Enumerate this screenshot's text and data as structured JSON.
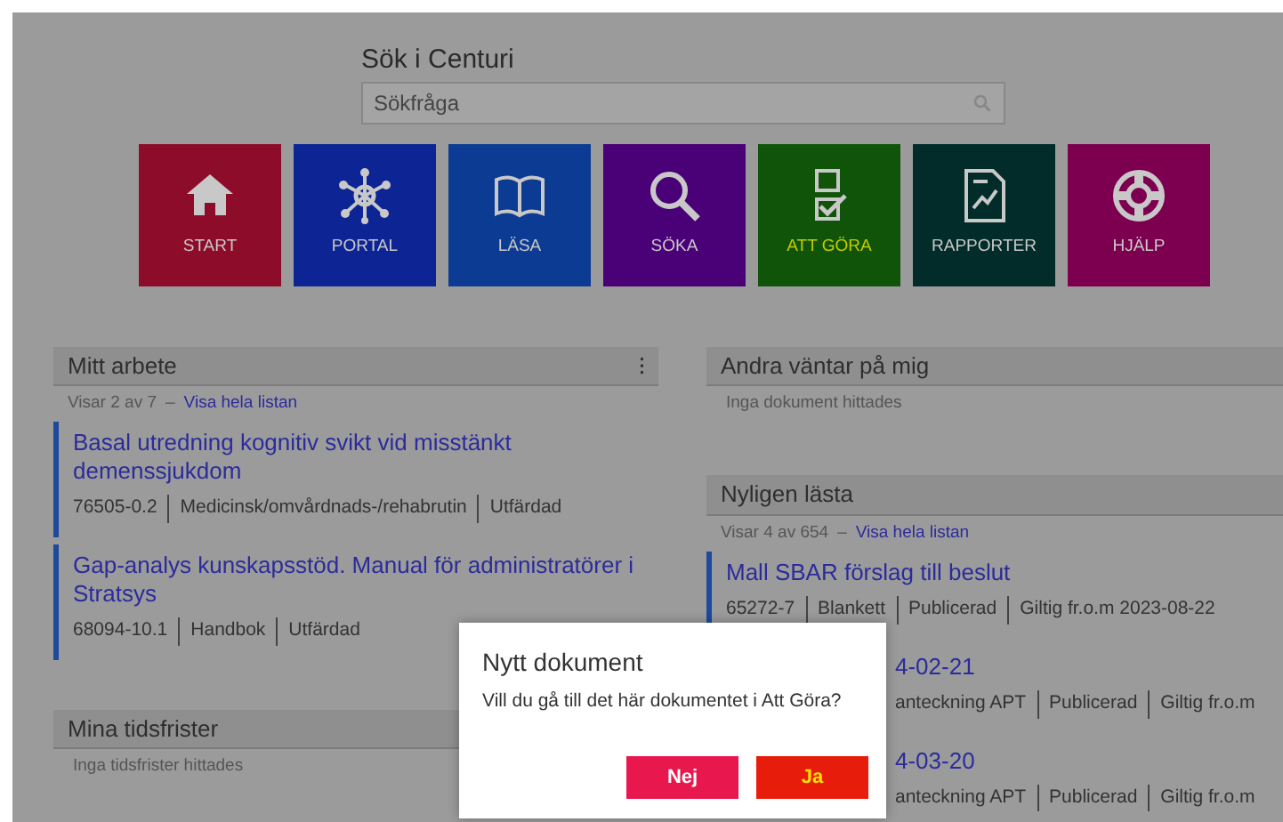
{
  "search": {
    "title": "Sök i Centuri",
    "placeholder": "Sökfråga"
  },
  "tiles": [
    {
      "kind": "home",
      "label": "START",
      "color": "#8c0c2a",
      "selected": false
    },
    {
      "kind": "network",
      "label": "PORTAL",
      "color": "#0d2494",
      "selected": false
    },
    {
      "kind": "book",
      "label": "LÄSA",
      "color": "#0c3b94",
      "selected": false
    },
    {
      "kind": "search",
      "label": "SÖKA",
      "color": "#4a0077",
      "selected": false
    },
    {
      "kind": "checklist",
      "label": "ATT GÖRA",
      "color": "#10540a",
      "selected": true
    },
    {
      "kind": "report",
      "label": "RAPPORTER",
      "color": "#012c29",
      "selected": false
    },
    {
      "kind": "lifebuoy",
      "label": "HJÄLP",
      "color": "#7d0050",
      "selected": false
    }
  ],
  "columns": [
    [
      {
        "title": "Mitt arbete",
        "menu": "⁝",
        "count": "Visar 2 av 7",
        "separator": "–",
        "link": "Visa hela listan",
        "items": [
          {
            "title": "Basal utredning kognitiv svikt vid misstänkt demenssjukdom",
            "meta": [
              "76505-0.2",
              "Medicinsk/omvårdnads-/rehabrutin",
              "Utfärdad"
            ],
            "partial": false
          },
          {
            "title": "Gap-analys kunskapsstöd. Manual för administratörer i Stratsys",
            "meta": [
              "68094-10.1",
              "Handbok",
              "Utfärdad"
            ],
            "partial": false
          }
        ]
      },
      {
        "title": "Mina tidsfrister",
        "empty": "Inga tidsfrister hittades"
      }
    ],
    [
      {
        "title": "Andra väntar på mig",
        "empty": "Inga dokument hittades"
      },
      {
        "title": "Nyligen lästa",
        "count": "Visar 4 av 654",
        "separator": "–",
        "link": "Visa hela listan",
        "items": [
          {
            "title": "Mall SBAR förslag till beslut",
            "meta": [
              "65272-7",
              "Blankett",
              "Publicerad",
              "Giltig fr.o.m 2023-08-22"
            ],
            "partial": false
          },
          {
            "title": "4-02-21",
            "meta": [
              "anteckning APT",
              "Publicerad",
              "Giltig fr.o.m"
            ],
            "partial": true
          },
          {
            "title": "4-03-20",
            "meta": [
              "anteckning APT",
              "Publicerad",
              "Giltig fr.o.m"
            ],
            "partial": true
          }
        ]
      }
    ]
  ],
  "dialog": {
    "title": "Nytt dokument",
    "message": "Vill du gå till det här dokumentet i Att Göra?",
    "buttons": [
      {
        "label": "Nej",
        "selected": false
      },
      {
        "label": "Ja",
        "selected": true
      }
    ]
  }
}
